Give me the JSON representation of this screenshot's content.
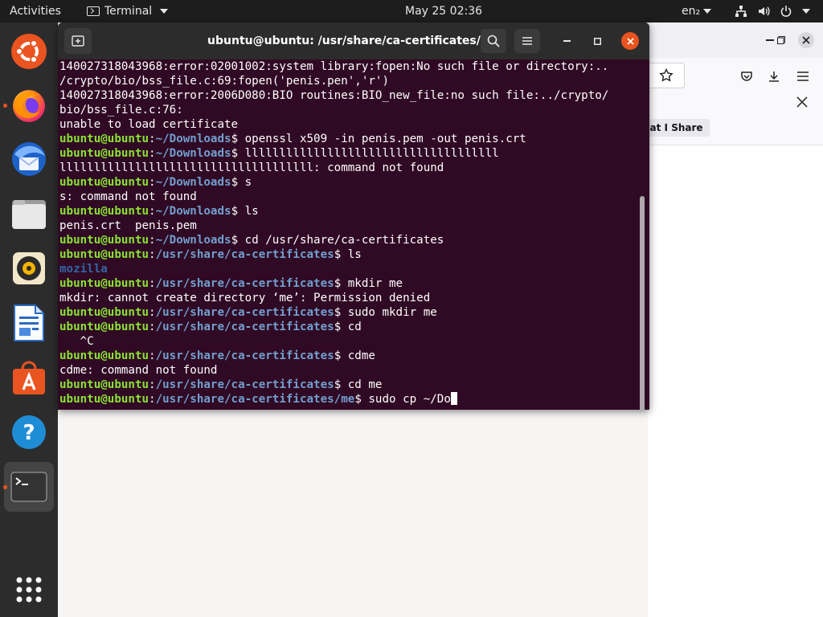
{
  "topbar": {
    "activities": "Activities",
    "app_menu": "Terminal",
    "clock": "May 25  02:36",
    "lang": "en₂",
    "tray_icons": [
      "network-icon",
      "volume-icon",
      "power-icon",
      "system-menu-caret"
    ]
  },
  "dock": {
    "items": [
      {
        "name": "ubuntu-software-center"
      },
      {
        "name": "firefox",
        "running": true
      },
      {
        "name": "thunderbird"
      },
      {
        "name": "files"
      },
      {
        "name": "rhythmbox"
      },
      {
        "name": "libreoffice-writer"
      },
      {
        "name": "ubuntu-software"
      },
      {
        "name": "help"
      },
      {
        "name": "terminal",
        "running": true,
        "active": true
      },
      {
        "name": "show-applications"
      }
    ]
  },
  "terminal": {
    "title": "ubuntu@ubuntu: /usr/share/ca-certificates/me",
    "lines": [
      [
        {
          "t": "140027318043968:error:02001002:system library:fopen:No such file or directory:..",
          "c": "w"
        }
      ],
      [
        {
          "t": "/crypto/bio/bss_file.c:69:fopen('penis.pen','r')",
          "c": "w"
        }
      ],
      [
        {
          "t": "140027318043968:error:2006D080:BIO routines:BIO_new_file:no such file:../crypto/",
          "c": "w"
        }
      ],
      [
        {
          "t": "bio/bss_file.c:76:",
          "c": "w"
        }
      ],
      [
        {
          "t": "unable to load certificate",
          "c": "w"
        }
      ],
      [
        {
          "t": "ubuntu@ubuntu",
          "c": "u"
        },
        {
          "t": ":",
          "c": "w"
        },
        {
          "t": "~/Downloads",
          "c": "p"
        },
        {
          "t": "$ openssl x509 -in penis.pem -out penis.crt",
          "c": "w"
        }
      ],
      [
        {
          "t": "ubuntu@ubuntu",
          "c": "u"
        },
        {
          "t": ":",
          "c": "w"
        },
        {
          "t": "~/Downloads",
          "c": "p"
        },
        {
          "t": "$ lllllllllllllllllllllllllllllllllllll",
          "c": "w"
        }
      ],
      [
        {
          "t": "lllllllllllllllllllllllllllllllllllll: command not found",
          "c": "w"
        }
      ],
      [
        {
          "t": "ubuntu@ubuntu",
          "c": "u"
        },
        {
          "t": ":",
          "c": "w"
        },
        {
          "t": "~/Downloads",
          "c": "p"
        },
        {
          "t": "$ s",
          "c": "w"
        }
      ],
      [
        {
          "t": "s: command not found",
          "c": "w"
        }
      ],
      [
        {
          "t": "ubuntu@ubuntu",
          "c": "u"
        },
        {
          "t": ":",
          "c": "w"
        },
        {
          "t": "~/Downloads",
          "c": "p"
        },
        {
          "t": "$ ls",
          "c": "w"
        }
      ],
      [
        {
          "t": "penis.crt  penis.pem",
          "c": "w"
        }
      ],
      [
        {
          "t": "ubuntu@ubuntu",
          "c": "u"
        },
        {
          "t": ":",
          "c": "w"
        },
        {
          "t": "~/Downloads",
          "c": "p"
        },
        {
          "t": "$ cd /usr/share/ca-certificates",
          "c": "w"
        }
      ],
      [
        {
          "t": "ubuntu@ubuntu",
          "c": "u"
        },
        {
          "t": ":",
          "c": "w"
        },
        {
          "t": "/usr/share/ca-certificates",
          "c": "p"
        },
        {
          "t": "$ ls",
          "c": "w"
        }
      ],
      [
        {
          "t": "mozilla",
          "c": "dir"
        }
      ],
      [
        {
          "t": "ubuntu@ubuntu",
          "c": "u"
        },
        {
          "t": ":",
          "c": "w"
        },
        {
          "t": "/usr/share/ca-certificates",
          "c": "p"
        },
        {
          "t": "$ mkdir me",
          "c": "w"
        }
      ],
      [
        {
          "t": "mkdir: cannot create directory ‘me’: Permission denied",
          "c": "w"
        }
      ],
      [
        {
          "t": "ubuntu@ubuntu",
          "c": "u"
        },
        {
          "t": ":",
          "c": "w"
        },
        {
          "t": "/usr/share/ca-certificates",
          "c": "p"
        },
        {
          "t": "$ sudo mkdir me",
          "c": "w"
        }
      ],
      [
        {
          "t": "ubuntu@ubuntu",
          "c": "u"
        },
        {
          "t": ":",
          "c": "w"
        },
        {
          "t": "/usr/share/ca-certificates",
          "c": "p"
        },
        {
          "t": "$ cd",
          "c": "w"
        }
      ],
      [
        {
          "t": "   ^C",
          "c": "w"
        }
      ],
      [
        {
          "t": "ubuntu@ubuntu",
          "c": "u"
        },
        {
          "t": ":",
          "c": "w"
        },
        {
          "t": "/usr/share/ca-certificates",
          "c": "p"
        },
        {
          "t": "$ cdme",
          "c": "w"
        }
      ],
      [
        {
          "t": "cdme: command not found",
          "c": "w"
        }
      ],
      [
        {
          "t": "ubuntu@ubuntu",
          "c": "u"
        },
        {
          "t": ":",
          "c": "w"
        },
        {
          "t": "/usr/share/ca-certificates",
          "c": "p"
        },
        {
          "t": "$ cd me",
          "c": "w"
        }
      ],
      [
        {
          "t": "ubuntu@ubuntu",
          "c": "u"
        },
        {
          "t": ":",
          "c": "w"
        },
        {
          "t": "/usr/share/ca-certificates/me",
          "c": "p"
        },
        {
          "t": "$ sudo cp ~/Do",
          "c": "w"
        }
      ]
    ],
    "cursor_on_last_line": true
  },
  "firefox": {
    "notification_button": "hat I Share"
  },
  "colors": {
    "terminal_bg": "#300a24",
    "prompt_user": "#8ae234",
    "prompt_path": "#729fcf",
    "directory": "#3465a4",
    "accent_orange": "#e95420"
  }
}
